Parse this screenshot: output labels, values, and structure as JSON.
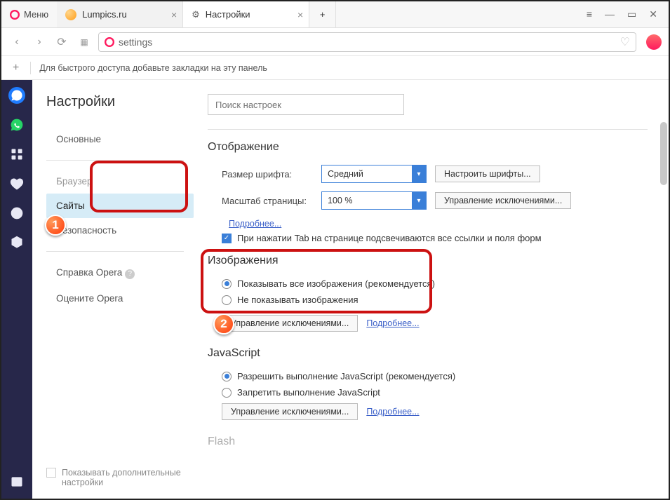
{
  "menu_label": "Меню",
  "tabs": [
    {
      "title": "Lumpics.ru",
      "favicon": "#ffb347"
    },
    {
      "title": "Настройки",
      "favicon": "gear"
    }
  ],
  "address_bar": {
    "value": "settings"
  },
  "bookmark_bar_hint": "Для быстрого доступа добавьте закладки на эту панель",
  "settings_title": "Настройки",
  "nav_items": [
    {
      "label": "Основные",
      "key": "basic"
    },
    {
      "label": "Браузер",
      "key": "browser"
    },
    {
      "label": "Сайты",
      "key": "sites",
      "active": true
    },
    {
      "label": "Безопасность",
      "key": "security"
    }
  ],
  "nav_bottom": [
    {
      "label": "Справка Opera",
      "key": "help",
      "icon": true
    },
    {
      "label": "Оцените Opera",
      "key": "rate"
    }
  ],
  "search_placeholder": "Поиск настроек",
  "display": {
    "title": "Отображение",
    "font_size_label": "Размер шрифта:",
    "font_size_value": "Средний",
    "font_size_btn": "Настроить шрифты...",
    "zoom_label": "Масштаб страницы:",
    "zoom_value": "100 %",
    "zoom_btn": "Управление исключениями...",
    "more_link": "Подробнее...",
    "tab_hint": "При нажатии Tab на странице подсвечиваются все ссылки и поля форм"
  },
  "images": {
    "title": "Изображения",
    "opt1": "Показывать все изображения (рекомендуется)",
    "opt2": "Не показывать изображения",
    "manage_btn": "Управление исключениями...",
    "more_link": "Подробнее..."
  },
  "js": {
    "title": "JavaScript",
    "opt1": "Разрешить выполнение JavaScript (рекомендуется)",
    "opt2": "Запретить выполнение JavaScript",
    "manage_btn": "Управление исключениями...",
    "more_link": "Подробнее..."
  },
  "flash_title": "Flash",
  "adv_settings_label": "Показывать дополнительные настройки",
  "callouts": {
    "one": "1",
    "two": "2"
  }
}
